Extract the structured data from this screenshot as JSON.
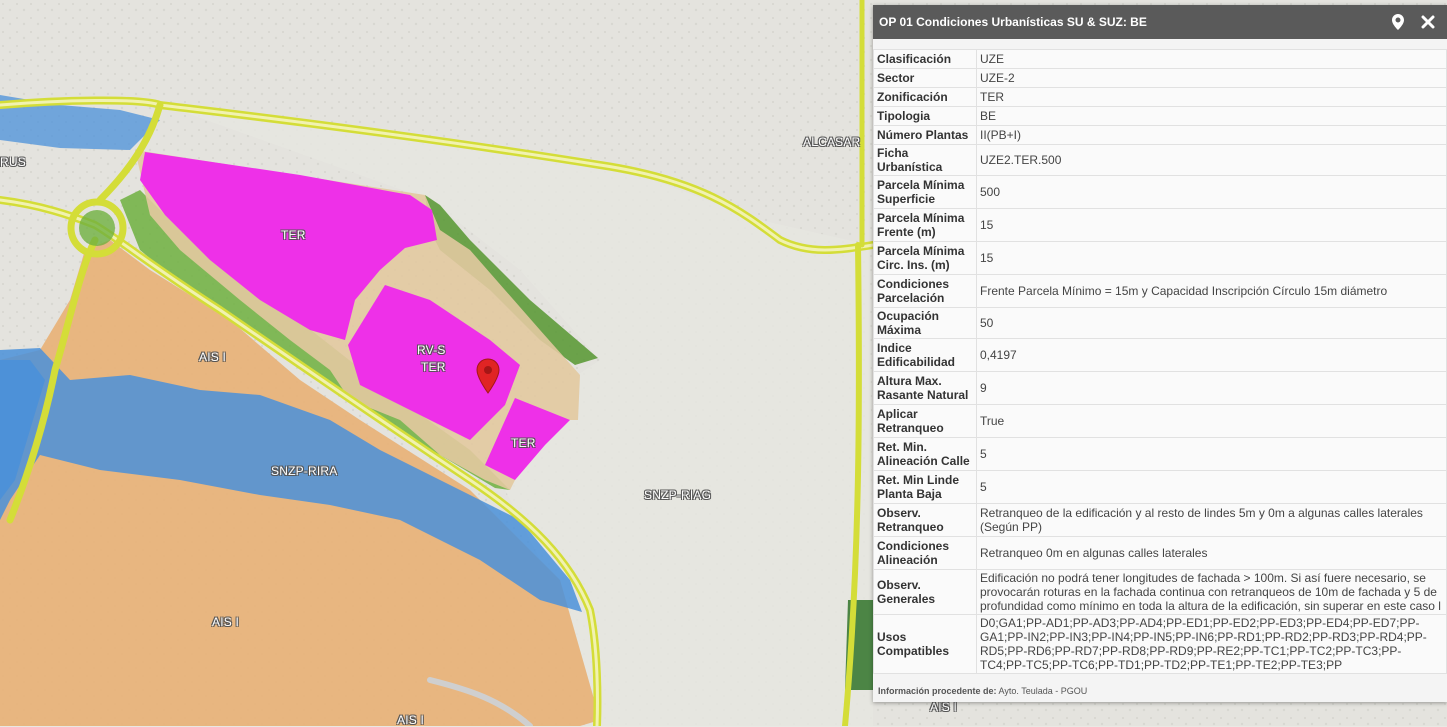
{
  "map": {
    "labels": [
      {
        "name": "map-label-ter-1",
        "text": "TER"
      },
      {
        "name": "map-label-rvs",
        "text": "RV-S"
      },
      {
        "name": "map-label-ter-2",
        "text": "TER"
      },
      {
        "name": "map-label-ter-3",
        "text": "TER"
      },
      {
        "name": "map-label-ais-1",
        "text": "AIS I"
      },
      {
        "name": "map-label-snzp-rira",
        "text": "SNZP-RIRA"
      },
      {
        "name": "map-label-snzp-riag",
        "text": "SNZP-RIAG"
      },
      {
        "name": "map-label-ais-2",
        "text": "AIS I"
      },
      {
        "name": "map-label-ais-3",
        "text": "AIS I"
      },
      {
        "name": "map-label-ais-4",
        "text": "AIS I"
      },
      {
        "name": "map-label-alcasar",
        "text": "ALCASAR"
      },
      {
        "name": "map-label-rus",
        "text": "RUS"
      }
    ]
  },
  "panel": {
    "title": "OP 01 Condiciones Urbanísticas SU & SUZ: BE",
    "rows": [
      {
        "key": "Clasificación",
        "value": "UZE"
      },
      {
        "key": "Sector",
        "value": "UZE-2"
      },
      {
        "key": "Zonificación",
        "value": "TER"
      },
      {
        "key": "Tipologia",
        "value": "BE"
      },
      {
        "key": "Número Plantas",
        "value": "II(PB+I)"
      },
      {
        "key": "Ficha Urbanística",
        "value": "UZE2.TER.500"
      },
      {
        "key": "Parcela Mínima Superficie",
        "value": "500"
      },
      {
        "key": "Parcela Mínima Frente (m)",
        "value": "15"
      },
      {
        "key": "Parcela Mínima Circ. Ins. (m)",
        "value": "15"
      },
      {
        "key": "Condiciones Parcelación",
        "value": "Frente Parcela Mínimo = 15m y Capacidad Inscripción Círculo 15m diámetro"
      },
      {
        "key": "Ocupación Máxima",
        "value": "50"
      },
      {
        "key": "Indice Edificabilidad",
        "value": "0,4197"
      },
      {
        "key": "Altura Max. Rasante Natural",
        "value": "9"
      },
      {
        "key": "Aplicar Retranqueo",
        "value": "True"
      },
      {
        "key": "Ret. Min. Alineación Calle",
        "value": "5"
      },
      {
        "key": "Ret. Min Linde Planta Baja",
        "value": "5"
      },
      {
        "key": "Observ. Retranqueo",
        "value": "Retranqueo de la edificación y al resto de lindes 5m y 0m a algunas calles laterales (Según PP)"
      },
      {
        "key": "Condiciones Alineación",
        "value": "Retranqueo 0m en algunas calles laterales"
      },
      {
        "key": "Observ. Generales",
        "value": "Edificación no podrá tener longitudes de fachada > 100m. Si así fuere necesario, se provocarán roturas en la fachada continua con retranqueos de 10m de fachada y 5 de profundidad como mínimo en toda la altura de la edificación, sin superar en este caso l"
      },
      {
        "key": "Usos Compatibles",
        "value": "D0;GA1;PP-AD1;PP-AD3;PP-AD4;PP-ED1;PP-ED2;PP-ED3;PP-ED4;PP-ED7;PP-GA1;PP-IN2;PP-IN3;PP-IN4;PP-IN5;PP-IN6;PP-RD1;PP-RD2;PP-RD3;PP-RD4;PP-RD5;PP-RD6;PP-RD7;PP-RD8;PP-RD9;PP-RE2;PP-TC1;PP-TC2;PP-TC3;PP-TC4;PP-TC5;PP-TC6;PP-TD1;PP-TD2;PP-TE1;PP-TE2;PP-TE3;PP"
      }
    ],
    "footer_label": "Información procedente de:",
    "footer_source": "Ayto. Teulada - PGOU"
  },
  "colors": {
    "ter": "#ee30e8",
    "ais": "#e8b37a",
    "snzp_rira": "#4a90d9",
    "snzp_riag": "#e6e6e0",
    "road_outline": "#d4dd38",
    "green_zone": "#5d9a3a",
    "panel_header": "#5a5a5a",
    "marker": "#e02424"
  },
  "icons": {
    "locate": "map-marker-icon",
    "close": "close-icon",
    "marker": "map-pin-icon"
  }
}
